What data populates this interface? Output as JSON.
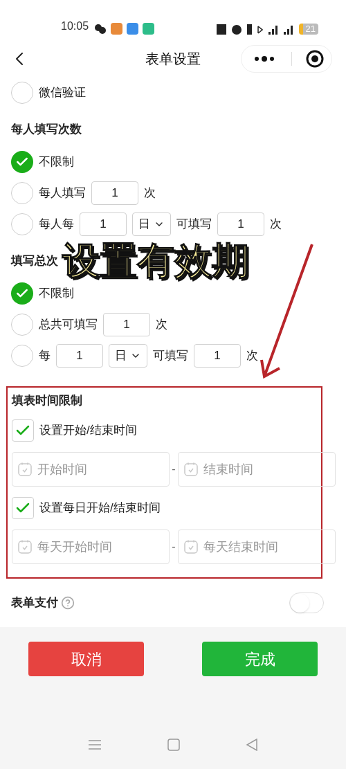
{
  "status_bar": {
    "time": "10:05",
    "battery": "21"
  },
  "header": {
    "title": "表单设置"
  },
  "sections": [
    {
      "rows": [
        {
          "selected": false,
          "parts": [
            {
              "kind": "text",
              "text": "微信验证"
            }
          ]
        }
      ]
    },
    {
      "title": "每人填写次数",
      "rows": [
        {
          "selected": true,
          "parts": [
            {
              "kind": "text",
              "text": "不限制"
            }
          ]
        },
        {
          "selected": false,
          "parts": [
            {
              "kind": "text",
              "text": "每人填写"
            },
            {
              "kind": "input",
              "value": "1"
            },
            {
              "kind": "text",
              "text": "次"
            }
          ]
        },
        {
          "selected": false,
          "parts": [
            {
              "kind": "text",
              "text": "每人每"
            },
            {
              "kind": "input",
              "value": "1"
            },
            {
              "kind": "select",
              "value": "日"
            },
            {
              "kind": "text",
              "text": "可填写"
            },
            {
              "kind": "input",
              "value": "1"
            },
            {
              "kind": "text",
              "text": "次"
            }
          ]
        }
      ]
    },
    {
      "title": "填写总次",
      "rows": [
        {
          "selected": true,
          "parts": [
            {
              "kind": "text",
              "text": "不限制"
            }
          ]
        },
        {
          "selected": false,
          "parts": [
            {
              "kind": "text",
              "text": "总共可填写"
            },
            {
              "kind": "input",
              "value": "1"
            },
            {
              "kind": "text",
              "text": "次"
            }
          ]
        },
        {
          "selected": false,
          "parts": [
            {
              "kind": "text",
              "text": "每"
            },
            {
              "kind": "input",
              "value": "1"
            },
            {
              "kind": "select",
              "value": "日"
            },
            {
              "kind": "text",
              "text": "可填写"
            },
            {
              "kind": "input",
              "value": "1"
            },
            {
              "kind": "text",
              "text": "次"
            }
          ]
        }
      ]
    }
  ],
  "time_limit": {
    "title": "填表时间限制",
    "highlighted": true,
    "items": [
      {
        "kind": "checkbox",
        "label": "设置开始/结束时间",
        "checked": true
      },
      {
        "kind": "range",
        "start": {
          "placeholder": "开始时间"
        },
        "separator": "-",
        "end": {
          "placeholder": "结束时间"
        }
      },
      {
        "kind": "checkbox",
        "label": "设置每日开始/结束时间",
        "checked": true
      },
      {
        "kind": "range",
        "start": {
          "placeholder": "每天开始时间"
        },
        "separator": "-",
        "end": {
          "placeholder": "每天结束时间"
        }
      }
    ]
  },
  "payment": {
    "label": "表单支付",
    "on": false
  },
  "buttons": [
    {
      "kind": "cancel",
      "label": "取消"
    },
    {
      "kind": "confirm",
      "label": "完成"
    }
  ],
  "overlay": {
    "caption": "设置有效期"
  }
}
